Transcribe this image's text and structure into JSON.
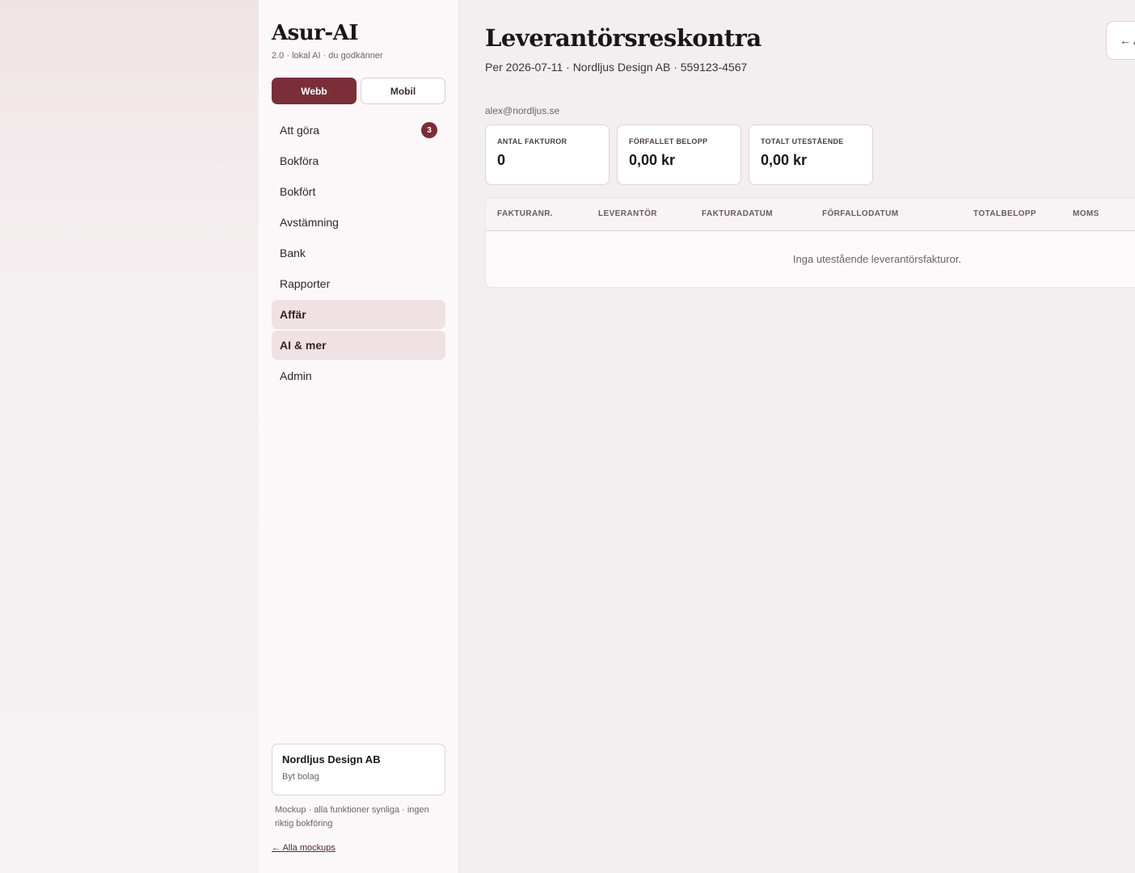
{
  "sidebar": {
    "brand": "Asur-AI",
    "brand_sub": "2.0 · lokal AI · du godkänner",
    "mode": {
      "web": "Webb",
      "mobile": "Mobil",
      "active": "Webb"
    },
    "items": [
      {
        "label": "Att göra",
        "badge": "3"
      },
      {
        "label": "Bokföra"
      },
      {
        "label": "Bokfört"
      },
      {
        "label": "Avstämning"
      },
      {
        "label": "Bank"
      },
      {
        "label": "Rapporter"
      },
      {
        "label": "Affär"
      },
      {
        "label": "AI & mer"
      },
      {
        "label": "Admin"
      }
    ],
    "company": {
      "name": "Nordljus Design AB",
      "switch": "Byt bolag"
    },
    "footnote": "Mockup · alla funktioner synliga · ingen riktig bokföring",
    "all_mockups": "← Alla mockups"
  },
  "main": {
    "title": "Leverantörsreskontra",
    "subtitle": "Per 2026-07-11 · Nordljus Design AB · 559123-4567",
    "back_label": "← A",
    "email": "alex@nordljus.se",
    "stats": [
      {
        "label": "ANTAL FAKTUROR",
        "value": "0"
      },
      {
        "label": "FÖRFALLET BELOPP",
        "value": "0,00 kr"
      },
      {
        "label": "TOTALT UTESTÅENDE",
        "value": "0,00 kr"
      }
    ],
    "table": {
      "columns": [
        "FAKTURANR.",
        "LEVERANTÖR",
        "FAKTURADATUM",
        "FÖRFALLODATUM",
        "TOTALBELOPP",
        "MOMS"
      ],
      "empty": "Inga utestående leverantörsfakturor."
    }
  },
  "colors": {
    "accent": "#7a2e38",
    "highlight": "#efe1e4",
    "sidebar_bg": "#fcf8f9",
    "main_bg": "#f3eff0"
  }
}
